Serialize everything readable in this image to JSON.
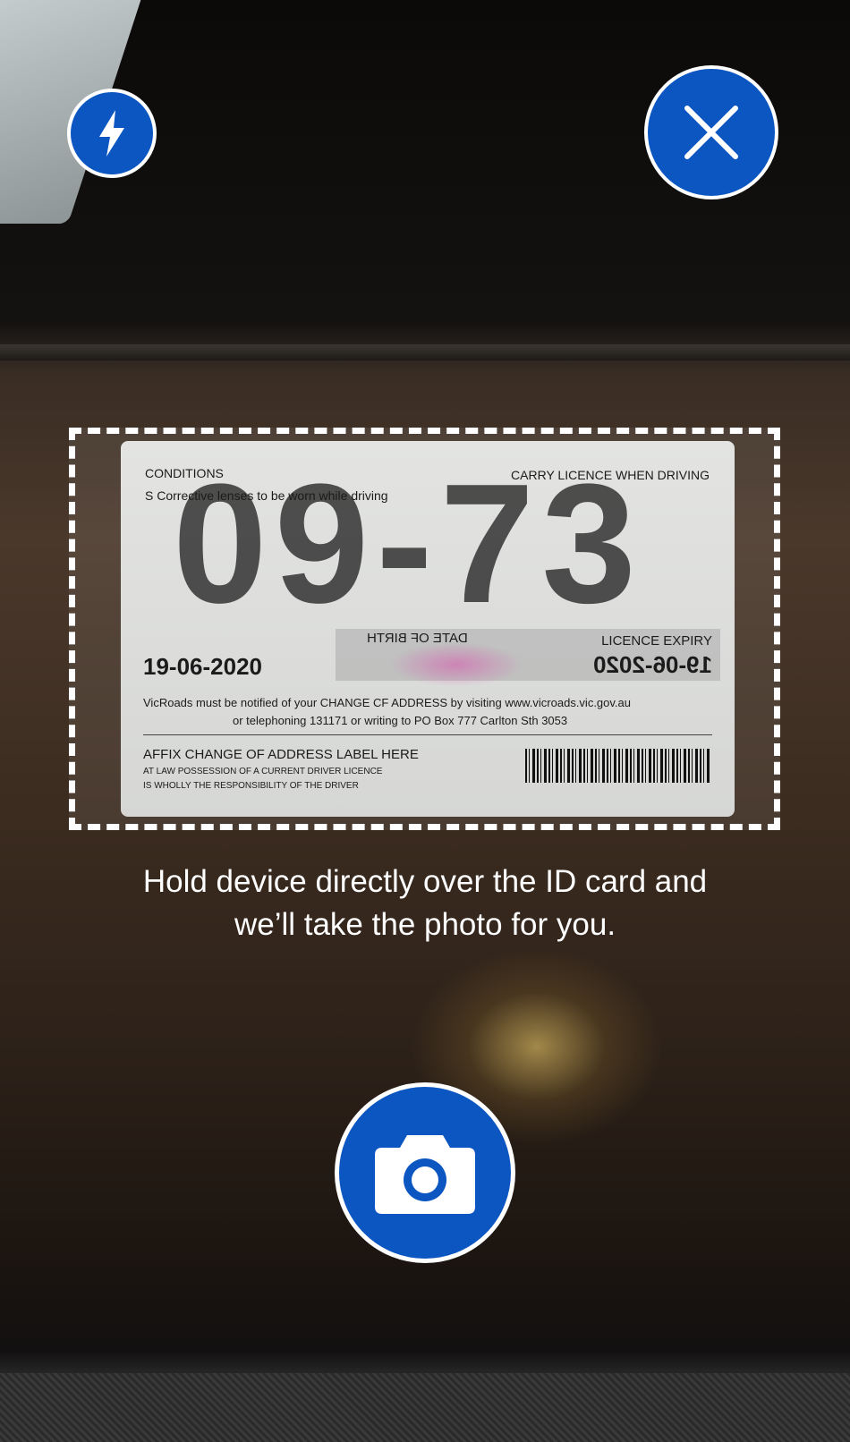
{
  "controls": {
    "flash_icon": "lightning-bolt",
    "close_icon": "x-mark",
    "shutter_icon": "camera"
  },
  "instruction": {
    "line1": "Hold device directly over the ID card and",
    "line2": "we’ll take the photo for you."
  },
  "id_card": {
    "conditions_label": "CONDITIONS",
    "carry_notice": "CARRY LICENCE WHEN DRIVING",
    "conditions_text": "S Corrective lenses to be worn while driving",
    "big_number": "09-73",
    "date_left": "19-06-2020",
    "dob_label": "DATE OF BIRTH",
    "expiry_label": "LICENCE EXPIRY",
    "expiry_value": "19-06-2020",
    "notice_line1": "VicRoads must be notified of your CHANGE CF ADDRESS by visiting www.vicroads.vic.gov.au",
    "notice_line2": "or telephoning 131171 or writing to PO Box 777 Carlton Sth 3053",
    "affix_label": "AFFIX CHANGE OF ADDRESS LABEL HERE",
    "law_line1": "AT LAW POSSESSION OF A CURRENT DRIVER LICENCE",
    "law_line2": "IS WHOLLY THE RESPONSIBILITY OF THE DRIVER"
  },
  "colors": {
    "accent": "#0c56c2",
    "icon": "#ffffff"
  }
}
